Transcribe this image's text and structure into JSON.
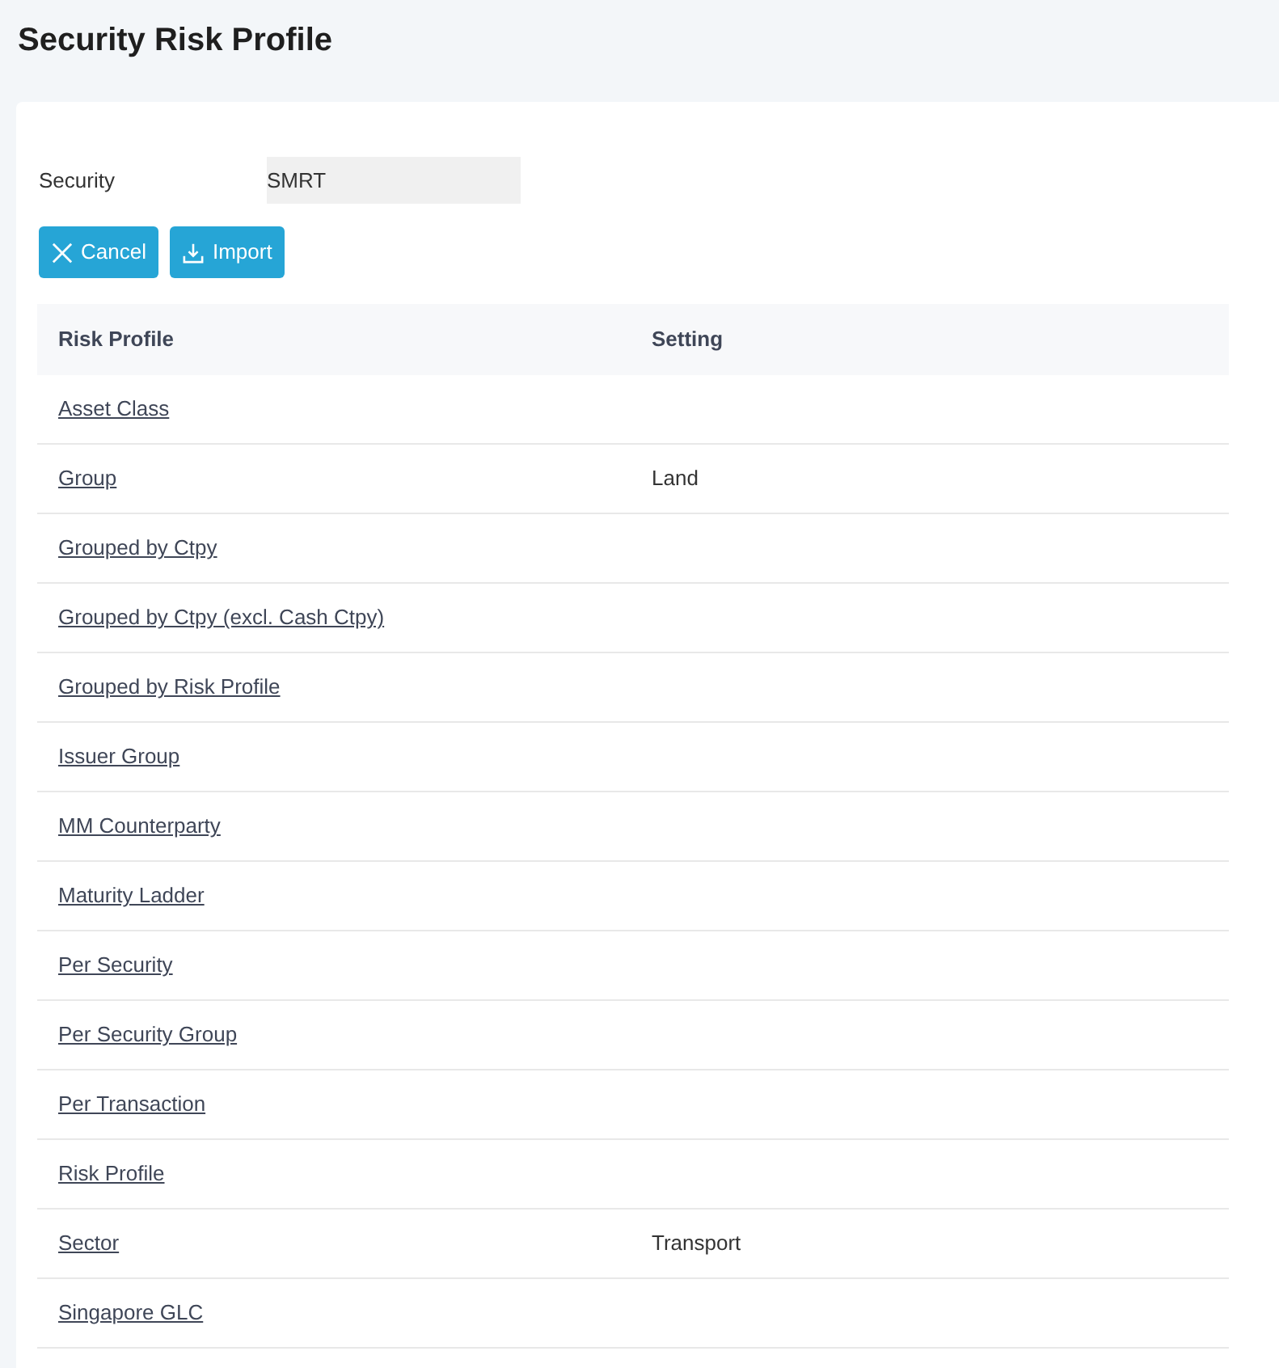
{
  "page_title": "Security Risk Profile",
  "security": {
    "label": "Security",
    "value": "SMRT"
  },
  "buttons": [
    {
      "kind": "cancel",
      "label": "Cancel"
    },
    {
      "kind": "import",
      "label": "Import"
    }
  ],
  "table": {
    "columns": [
      "Risk Profile",
      "Setting"
    ],
    "rows": [
      {
        "risk_profile": "Asset Class"
      },
      {
        "risk_profile": "Group",
        "setting": "Land"
      },
      {
        "risk_profile": "Grouped by Ctpy"
      },
      {
        "risk_profile": "Grouped by Ctpy (excl. Cash Ctpy)"
      },
      {
        "risk_profile": "Grouped by Risk Profile"
      },
      {
        "risk_profile": "Issuer Group"
      },
      {
        "risk_profile": "MM Counterparty"
      },
      {
        "risk_profile": "Maturity Ladder"
      },
      {
        "risk_profile": "Per Security"
      },
      {
        "risk_profile": "Per Security Group"
      },
      {
        "risk_profile": "Per Transaction"
      },
      {
        "risk_profile": "Risk Profile"
      },
      {
        "risk_profile": "Sector",
        "setting": "Transport"
      },
      {
        "risk_profile": "Singapore GLC"
      }
    ]
  }
}
